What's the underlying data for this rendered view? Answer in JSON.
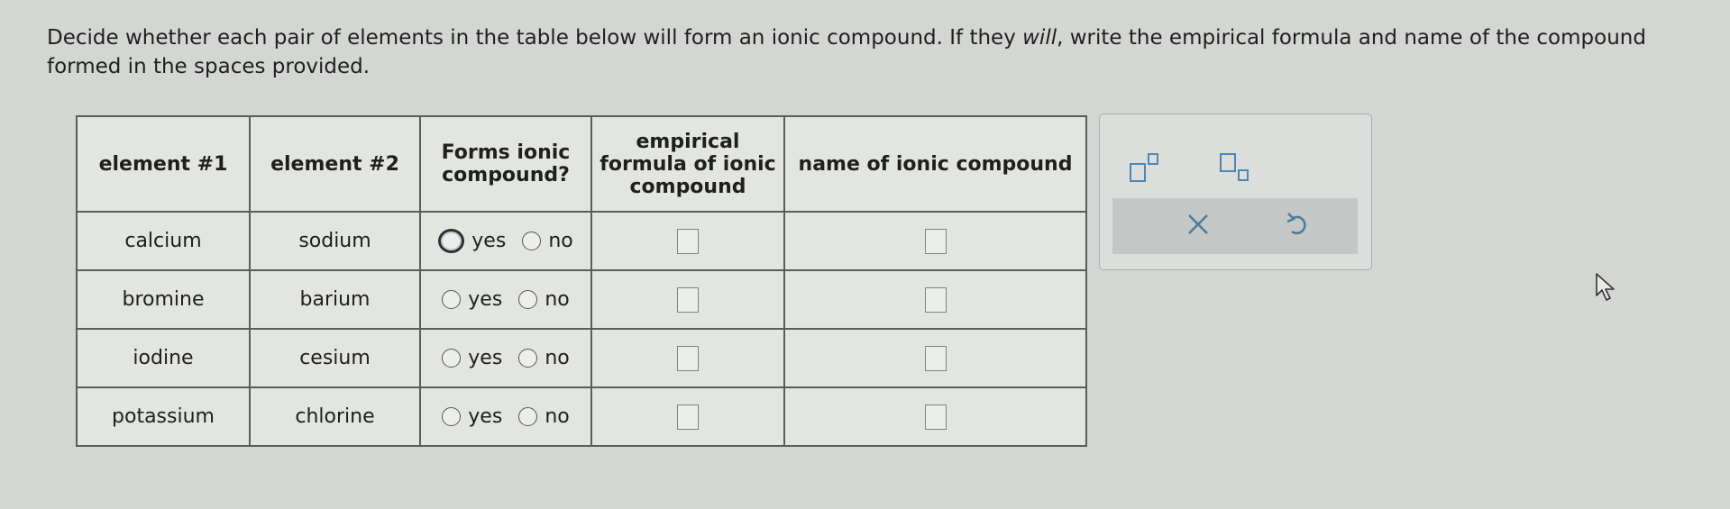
{
  "instructions": {
    "before_italic": "Decide whether each pair of elements in the table below will form an ionic compound. If they ",
    "italic": "will",
    "after_italic": ", write the empirical formula and name of the compound formed in the spaces provided."
  },
  "table": {
    "headers": {
      "element1": "element #1",
      "element2": "element #2",
      "forms_ionic": "Forms ionic compound?",
      "formula": "empirical formula of ionic compound",
      "name": "name of ionic compound"
    },
    "option_yes": "yes",
    "option_no": "no",
    "rows": [
      {
        "element1": "calcium",
        "element2": "sodium"
      },
      {
        "element1": "bromine",
        "element2": "barium"
      },
      {
        "element1": "iodine",
        "element2": "cesium"
      },
      {
        "element1": "potassium",
        "element2": "chlorine"
      }
    ]
  },
  "toolbox": {
    "icons": [
      "superscript-icon",
      "subscript-icon",
      "x-icon",
      "undo-icon"
    ]
  },
  "colors": {
    "background": "#d4d6d3",
    "table_border": "#5a5d5e",
    "toolbar_row": "#c4c7c5"
  }
}
